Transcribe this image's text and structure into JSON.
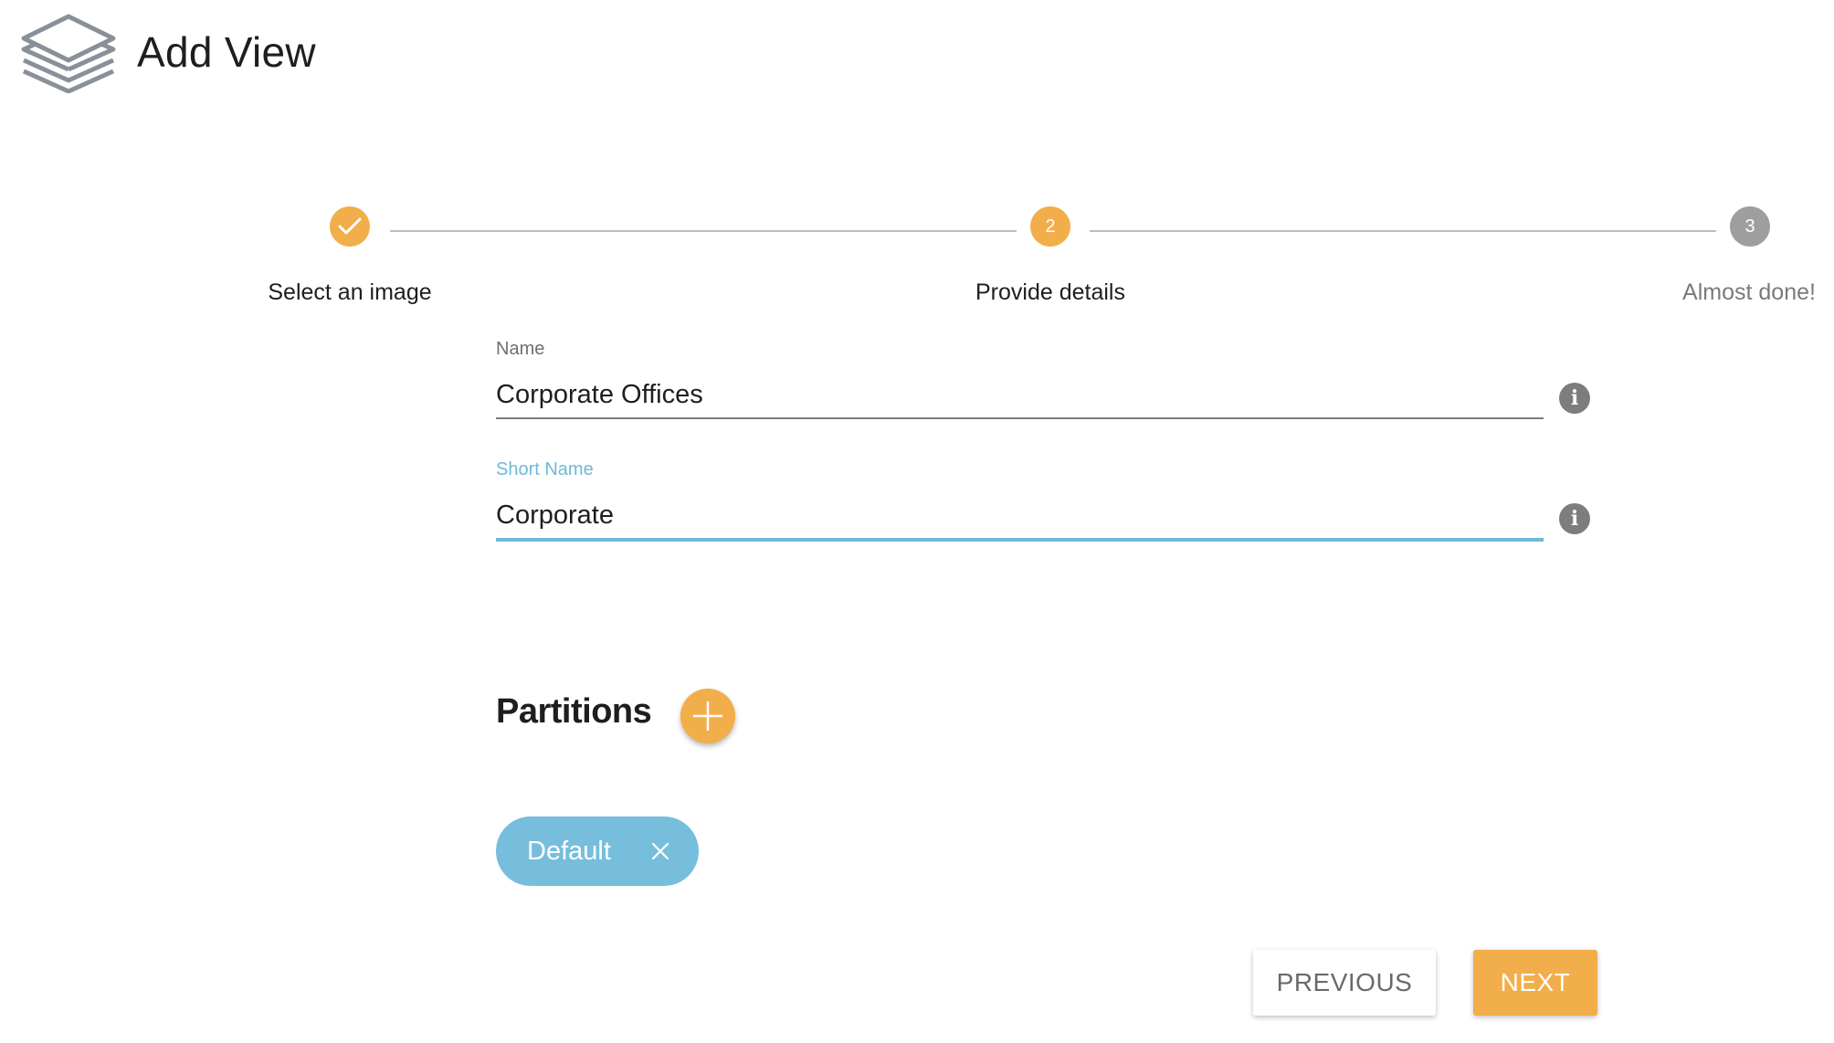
{
  "header": {
    "title": "Add View",
    "icon": "layers-icon"
  },
  "stepper": {
    "steps": [
      {
        "label": "Select an image",
        "number": "1",
        "state": "completed"
      },
      {
        "label": "Provide details",
        "number": "2",
        "state": "active"
      },
      {
        "label": "Almost done!",
        "number": "3",
        "state": "pending"
      }
    ]
  },
  "form": {
    "name": {
      "label": "Name",
      "value": "Corporate Offices"
    },
    "short_name": {
      "label": "Short Name",
      "value": "Corporate"
    }
  },
  "partitions": {
    "title": "Partitions",
    "chips": [
      {
        "label": "Default"
      }
    ]
  },
  "actions": {
    "previous_label": "PREVIOUS",
    "next_label": "NEXT"
  },
  "colors": {
    "accent": "#f2ae4a",
    "focus": "#6fb9d8",
    "chip": "#76bedc",
    "pending": "#9e9e9e"
  }
}
